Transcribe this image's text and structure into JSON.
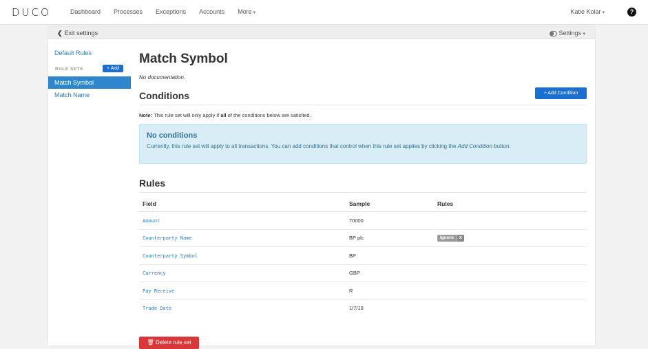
{
  "brand": {
    "logo": "DUCO"
  },
  "nav": {
    "items": [
      {
        "label": "Dashboard"
      },
      {
        "label": "Processes"
      },
      {
        "label": "Exceptions"
      },
      {
        "label": "Accounts"
      },
      {
        "label": "More"
      }
    ],
    "user": "Katie Kolar",
    "help_glyph": "?"
  },
  "settings_bar": {
    "exit_label": "Exit settings",
    "settings_label": "Settings"
  },
  "sidebar": {
    "default_rules": "Default Rules",
    "rule_sets_label": "RULE SETS",
    "add_label": "+ Add",
    "items": [
      {
        "label": "Match Symbol",
        "active": true
      },
      {
        "label": "Match Name",
        "active": false
      }
    ]
  },
  "main": {
    "title": "Match Symbol",
    "documentation": "No documentation.",
    "conditions": {
      "heading": "Conditions",
      "add_button": "+ Add Condition",
      "note_prefix": "Note:",
      "note_text_1": " This rule set will only apply if ",
      "note_bold": "all",
      "note_text_2": " of the conditions below are satisfied.",
      "alert_heading": "No conditions",
      "alert_text_1": "Currently, this rule set will apply to all transactions. You can add conditions that control when this rule set applies by clicking the ",
      "alert_em": "Add Condition",
      "alert_text_2": " button."
    },
    "rules": {
      "heading": "Rules",
      "columns": [
        "Field",
        "Sample",
        "Rules"
      ],
      "rows": [
        {
          "field": "Amount",
          "sample": "70000",
          "rule": ""
        },
        {
          "field": "Counterparty Name",
          "sample": "BP plc",
          "rule": "Ignore"
        },
        {
          "field": "Counterparty Symbol",
          "sample": "BP",
          "rule": ""
        },
        {
          "field": "Currency",
          "sample": "GBP",
          "rule": ""
        },
        {
          "field": "Pay Receive",
          "sample": "R",
          "rule": ""
        },
        {
          "field": "Trade Date",
          "sample": "1/7/19",
          "rule": ""
        }
      ],
      "tag_remove": "x"
    },
    "delete_button": "Delete rule set"
  },
  "colors": {
    "primary": "#1a6fd0",
    "link": "#2a7cbf",
    "danger": "#d9383a",
    "info_bg": "#d9edf7"
  }
}
